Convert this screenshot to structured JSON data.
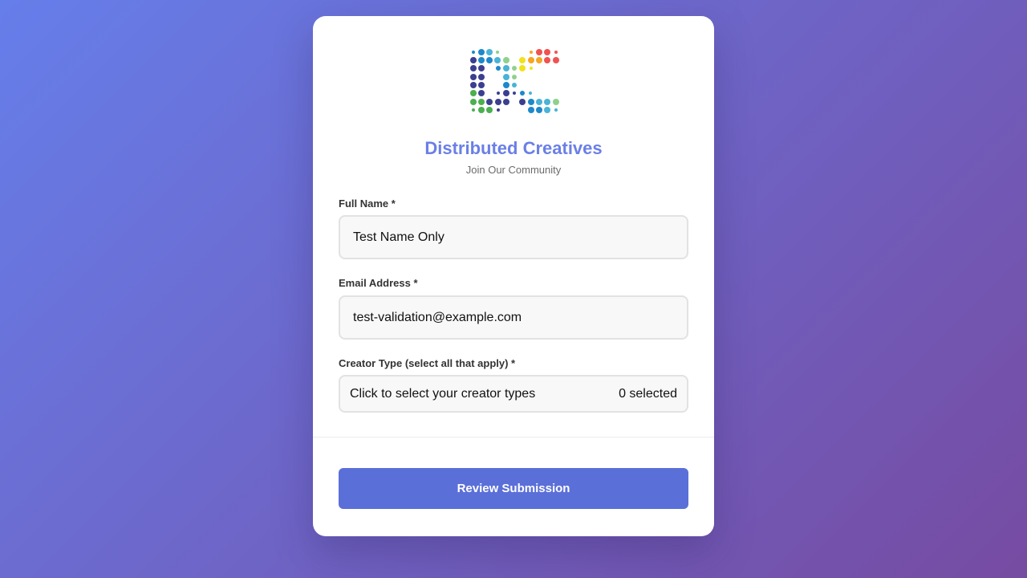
{
  "brand": {
    "title": "Distributed Creatives",
    "subtitle": "Join Our Community",
    "logo_colors": [
      "#3b3f8f",
      "#1e88c9",
      "#4ab3d6",
      "#8fd18c",
      "#f2e21b",
      "#f5a623",
      "#ef5350",
      "#4caf50"
    ]
  },
  "form": {
    "full_name": {
      "label": "Full Name *",
      "value": "Test Name Only"
    },
    "email": {
      "label": "Email Address *",
      "value": "test-validation@example.com"
    },
    "creator_type": {
      "label": "Creator Type (select all that apply) *",
      "placeholder": "Click to select your creator types",
      "count_text": "0 selected"
    }
  },
  "submit": {
    "label": "Review Submission"
  },
  "colors": {
    "accent": "#5a6fd8",
    "brand_text": "#6a7fe6",
    "bg_start": "#667eea",
    "bg_end": "#764ba2"
  }
}
